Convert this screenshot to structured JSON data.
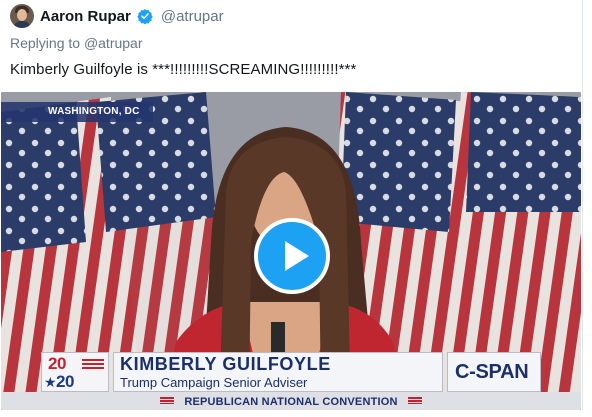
{
  "tweet": {
    "display_name": "Aaron Rupar",
    "handle": "@atrupar",
    "reply_prefix": "Replying to",
    "reply_to": "@atrupar",
    "text": "Kimberly Guilfoyle is ***!!!!!!!!!SCREAMING!!!!!!!!!***",
    "verified_icon": "verified-badge-icon"
  },
  "video": {
    "location_tag": "WASHINGTON, DC",
    "play_icon": "play-icon",
    "logo_top": "20",
    "logo_bottom": "20",
    "speaker_name": "KIMBERLY GUILFOYLE",
    "speaker_title": "Trump Campaign Senior Adviser",
    "network": "C-SPAN",
    "event": "REPUBLICAN NATIONAL CONVENTION"
  },
  "colors": {
    "accent": "#1da1f2",
    "text": "#14171a",
    "muted": "#657786",
    "broadcast_navy": "#1b2f6b",
    "broadcast_red": "#c8202f"
  }
}
